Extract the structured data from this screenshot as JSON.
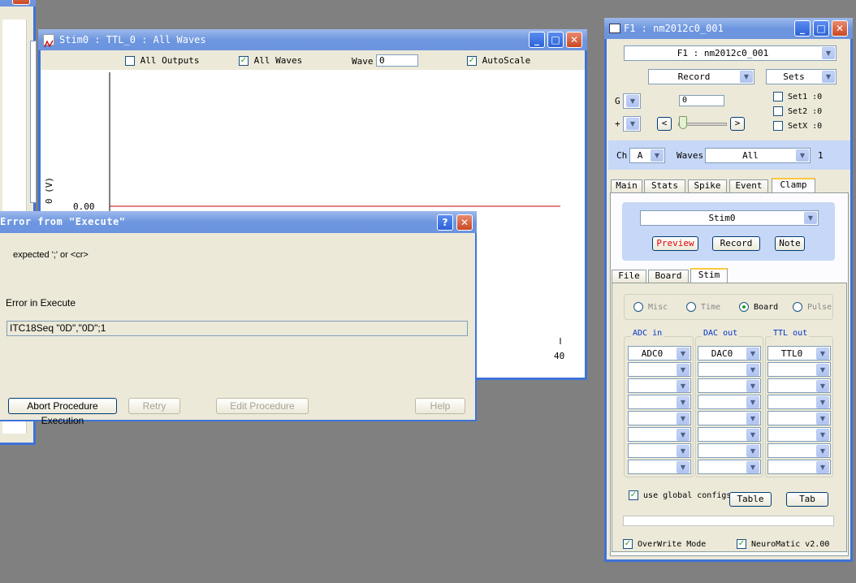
{
  "left_window": {
    "close_symbol": "✕"
  },
  "stim_window": {
    "title": "Stim0 : TTL_0 : All Waves",
    "min_symbol": "_",
    "max_symbol": "□",
    "close_symbol": "✕",
    "all_outputs_label": "All Outputs",
    "all_outputs_checked": false,
    "all_waves_label": "All Waves",
    "all_waves_checked": true,
    "wave_label": "Wave",
    "wave_value": "0",
    "autoscale_label": "AutoScale",
    "autoscale_checked": true,
    "y_axis_label": "0 (V)",
    "y_tick": "0.00",
    "x_tick_end": "40"
  },
  "chart_data": {
    "type": "line",
    "series": [
      {
        "x": [
          0,
          40
        ],
        "y": [
          0,
          0
        ],
        "color": "#cc0000"
      }
    ],
    "xlim": [
      0,
      40
    ],
    "y_ticks": [
      "0.00"
    ],
    "x_ticks": [
      "40"
    ]
  },
  "error_dialog": {
    "title": "Error from \"Execute\"",
    "help_symbol": "?",
    "close_symbol": "✕",
    "message": "expected ';' or <cr>",
    "error_label": "Error in Execute",
    "command_text": "ITC18Seq \"0D\",\"0D\";1",
    "abort_label": "Abort Procedure Execution",
    "retry_label": "Retry",
    "edit_label": "Edit Procedure",
    "help_label": "Help"
  },
  "nm_panel": {
    "title": "F1 : nm2012c0_001",
    "folder_select": "F1 : nm2012c0_001",
    "mode_select": "Record",
    "sets_select": "Sets",
    "g_label": "G",
    "plus_label": "+",
    "wave_num": "0",
    "set1_label": "Set1 :0",
    "set2_label": "Set2 :0",
    "setx_label": "SetX :0",
    "prev_symbol": "<",
    "next_symbol": ">",
    "ch_label": "Ch",
    "ch_value": "A",
    "waves_label": "Waves",
    "waves_value": "All",
    "waves_count": "1",
    "tabs": [
      "Main",
      "Stats",
      "Spike",
      "Event",
      "Clamp"
    ],
    "active_tab": "Clamp",
    "stim_select": "Stim0",
    "preview_label": "Preview",
    "record_label": "Record",
    "note_label": "Note",
    "subtabs": [
      "File",
      "Board",
      "Stim"
    ],
    "active_subtab": "Stim",
    "radios": [
      "Misc",
      "Time",
      "Board",
      "Pulse"
    ],
    "selected_radio": "Board",
    "adc_header": "ADC in",
    "dac_header": "DAC out",
    "ttl_header": "TTL out",
    "adc_values": [
      "ADC0",
      "",
      "",
      "",
      "",
      "",
      "",
      ""
    ],
    "dac_values": [
      "DAC0",
      "",
      "",
      "",
      "",
      "",
      "",
      ""
    ],
    "ttl_values": [
      "TTL0",
      "",
      "",
      "",
      "",
      "",
      "",
      ""
    ],
    "use_global_label": "use global configs",
    "use_global_checked": true,
    "table_label": "Table",
    "tab_label": "Tab",
    "overwrite_label": "OverWrite Mode",
    "overwrite_checked": true,
    "version_label": "NeuroMatic v2.00",
    "version_checked": true,
    "check_symbol": "✓"
  },
  "colors": {
    "titlebar": "#6e97e0",
    "panel_blue": "#c6d7f7",
    "preview_red": "#e00000",
    "header_blue": "#0033cc",
    "plot_line": "#cc0000"
  }
}
